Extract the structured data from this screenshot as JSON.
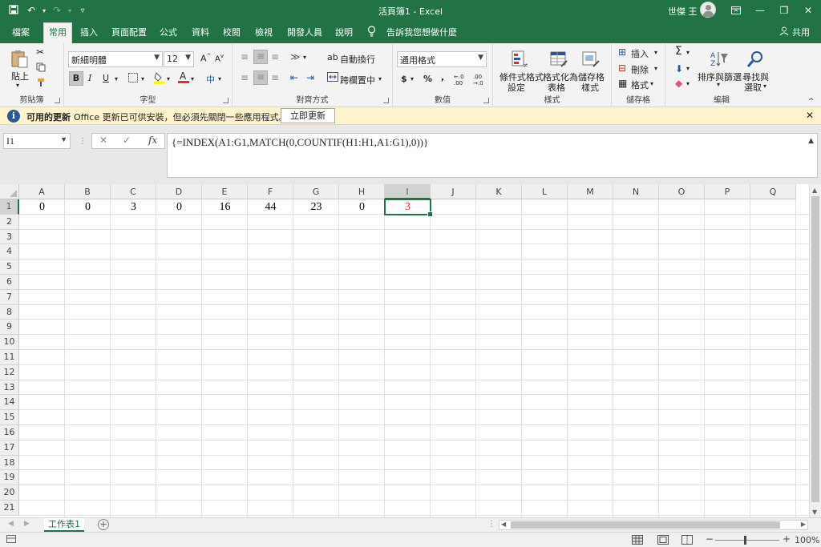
{
  "titlebar": {
    "title": "活頁簿1  -  Excel",
    "user": "世傑 王",
    "qat_save_icon": "save-icon",
    "qat_undo_icon": "undo-icon",
    "qat_redo_icon": "redo-icon",
    "qat_customize_icon": "customize-qat-icon"
  },
  "tabs": [
    "檔案",
    "常用",
    "插入",
    "頁面配置",
    "公式",
    "資料",
    "校閱",
    "檢視",
    "開發人員",
    "說明"
  ],
  "active_tab": "常用",
  "tell_me": "告訴我您想做什麼",
  "share": "共用",
  "ribbon": {
    "clipboard": {
      "label": "剪貼簿",
      "paste": "貼上"
    },
    "font": {
      "label": "字型",
      "font_name": "新細明體",
      "font_size": "12",
      "bold": "B",
      "italic": "I",
      "underline": "U"
    },
    "alignment": {
      "label": "對齊方式",
      "wrap_text": "自動換行",
      "merge_center": "跨欄置中"
    },
    "number": {
      "label": "數值",
      "format": "通用格式"
    },
    "styles": {
      "label": "樣式",
      "conditional_formatting_1": "條件式格式",
      "conditional_formatting_2": "設定",
      "format_as_table_1": "格式化為",
      "format_as_table_2": "表格",
      "cell_styles_1": "儲存格",
      "cell_styles_2": "樣式"
    },
    "cells": {
      "label": "儲存格",
      "insert": "插入",
      "delete": "刪除",
      "format": "格式"
    },
    "editing": {
      "label": "編輯",
      "sort_filter": "排序與篩選",
      "find_select_1": "尋找與",
      "find_select_2": "選取"
    }
  },
  "message_bar": {
    "title": "可用的更新",
    "text": "Office 更新已可供安裝，但必須先關閉一些應用程式。",
    "button": "立即更新"
  },
  "formula_bar": {
    "name_box": "I1",
    "fx_label": "fx",
    "formula": "{=INDEX(A1:G1,MATCH(0,COUNTIF(H1:H1,A1:G1),0))}"
  },
  "sheet": {
    "columns": [
      "A",
      "B",
      "C",
      "D",
      "E",
      "F",
      "G",
      "H",
      "I",
      "J",
      "K",
      "L",
      "M",
      "N",
      "O",
      "P",
      "Q"
    ],
    "selected_column": "I",
    "rows": [
      "1",
      "2",
      "3",
      "4",
      "5",
      "6",
      "7",
      "8",
      "9",
      "10",
      "11",
      "12",
      "13",
      "14",
      "15",
      "16",
      "17",
      "18",
      "19",
      "20",
      "21"
    ],
    "selected_row": "1",
    "row1_values": [
      "0",
      "0",
      "3",
      "0",
      "16",
      "44",
      "23",
      "0",
      "3"
    ],
    "highlight_color": "#e0302a",
    "accent_color": "#217346"
  },
  "sheet_tabs": [
    "工作表1"
  ],
  "status": {
    "zoom": "100%"
  }
}
